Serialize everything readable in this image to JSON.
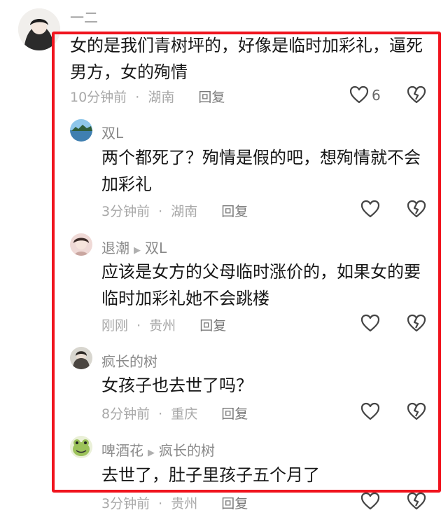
{
  "comments": [
    {
      "user": "一二",
      "text_lines": [
        "女的是我们青树坪的，好像是临时加彩礼，逼死",
        "男方，女的殉情"
      ],
      "time": "10分钟前",
      "location": "湖南",
      "reply_label": "回复",
      "like_count": "6"
    },
    {
      "user": "双L",
      "text_lines": [
        "两个都死了？殉情是假的吧，想殉情就不会",
        "加彩礼"
      ],
      "time": "3分钟前",
      "location": "湖南",
      "reply_label": "回复"
    },
    {
      "user": "退潮",
      "reply_to": "双L",
      "text_lines": [
        "应该是女方的父母临时涨价的，如果女的要",
        "临时加彩礼她不会跳楼"
      ],
      "time": "刚刚",
      "location": "贵州",
      "reply_label": "回复"
    },
    {
      "user": "疯长的树",
      "text_lines": [
        "女孩子也去世了吗？"
      ],
      "time": "8分钟前",
      "location": "重庆",
      "reply_label": "回复"
    },
    {
      "user": "啤酒花",
      "reply_to": "疯长的树",
      "text_lines": [
        "去世了，肚子里孩子五个月了"
      ],
      "time": "3分钟前",
      "location": "贵州",
      "reply_label": "回复"
    }
  ],
  "separator": "·",
  "colors": {
    "highlight_border": "#f0141e",
    "meta_text": "#a8a8a8",
    "username": "#8a8a8a"
  },
  "icons": {
    "like": "heart-outline-icon",
    "dislike": "broken-heart-icon",
    "reply_arrow": "triangle-right-icon"
  }
}
